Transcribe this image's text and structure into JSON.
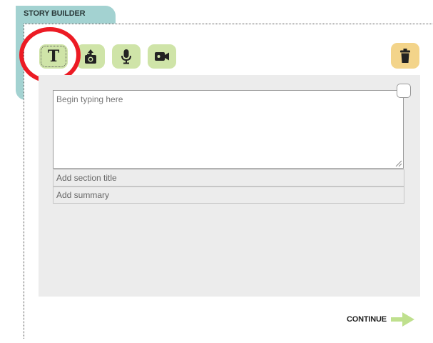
{
  "panel": {
    "title": "STORY BUILDER"
  },
  "toolbar": {
    "tools": [
      {
        "name": "text",
        "icon": "text-t-icon",
        "glyph": "T"
      },
      {
        "name": "photo",
        "icon": "camera-upload-icon"
      },
      {
        "name": "audio",
        "icon": "microphone-icon"
      },
      {
        "name": "video",
        "icon": "video-camera-icon"
      }
    ],
    "delete_icon": "trash-icon"
  },
  "editor": {
    "placeholder": "Begin typing here",
    "section_title_placeholder": "Add section title",
    "summary_placeholder": "Add summary"
  },
  "footer": {
    "continue_label": "CONTINUE",
    "continue_icon": "arrow-right-icon"
  },
  "colors": {
    "tab": "#a3d2d1",
    "tool_button": "#cfe4a8",
    "delete_button": "#f3d48a",
    "panel": "#ececec",
    "highlight_ring": "#ec1b24",
    "arrow": "#bfe08e"
  }
}
